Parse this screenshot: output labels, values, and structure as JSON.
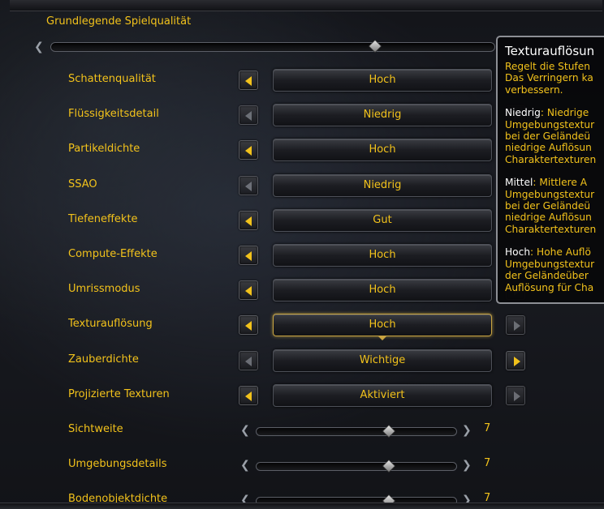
{
  "header": {
    "title": "Grundlegende Spielqualität"
  },
  "master_slider": {
    "level": 0.73
  },
  "dropdown_rows": [
    {
      "label": "Schattenqualität",
      "value": "Hoch",
      "left_enabled": true,
      "right_enabled": false
    },
    {
      "label": "Flüssigkeitsdetail",
      "value": "Niedrig",
      "left_enabled": false,
      "right_enabled": false
    },
    {
      "label": "Partikeldichte",
      "value": "Hoch",
      "left_enabled": true,
      "right_enabled": false
    },
    {
      "label": "SSAO",
      "value": "Niedrig",
      "left_enabled": false,
      "right_enabled": false
    },
    {
      "label": "Tiefeneffekte",
      "value": "Gut",
      "left_enabled": true,
      "right_enabled": false
    },
    {
      "label": "Compute-Effekte",
      "value": "Hoch",
      "left_enabled": true,
      "right_enabled": false
    },
    {
      "label": "Umrissmodus",
      "value": "Hoch",
      "left_enabled": true,
      "right_enabled": false
    },
    {
      "label": "Texturauflösung",
      "value": "Hoch",
      "left_enabled": true,
      "right_enabled": false,
      "active": true
    },
    {
      "label": "Zauberdichte",
      "value": "Wichtige",
      "left_enabled": false,
      "right_enabled": true
    },
    {
      "label": "Projizierte Texturen",
      "value": "Aktiviert",
      "left_enabled": true,
      "right_enabled": false
    }
  ],
  "slider_rows": [
    {
      "label": "Sichtweite",
      "value": "7",
      "level": 0.66
    },
    {
      "label": "Umgebungsdetails",
      "value": "7",
      "level": 0.66
    },
    {
      "label": "Bodenobjektdichte",
      "value": "7",
      "level": 0.66
    }
  ],
  "tooltip": {
    "title": "Texturauflösun",
    "intro": [
      "Regelt die Stufen",
      "Das Verringern ka",
      "verbessern."
    ],
    "sections": [
      {
        "term": "Niedrig",
        "lines": [
          ": Niedrige",
          "Umgebungstextur",
          "bei der Geländeü",
          "niedrige Auflösun",
          "Charaktertexturen"
        ]
      },
      {
        "term": "Mittel",
        "lines": [
          ": Mittlere A",
          "Umgebungstextur",
          "bei der Geländeü",
          "niedrige Auflösun",
          "Charaktertexturen"
        ]
      },
      {
        "term": "Hoch",
        "lines": [
          ": Hohe Auflö",
          "Umgebungstextur",
          "der Geländeüber",
          "Auflösung für Cha"
        ]
      }
    ]
  },
  "colors": {
    "label": "#f2c21b",
    "tooltip_border": "#8d8f95",
    "active_border": "#c9a441"
  }
}
